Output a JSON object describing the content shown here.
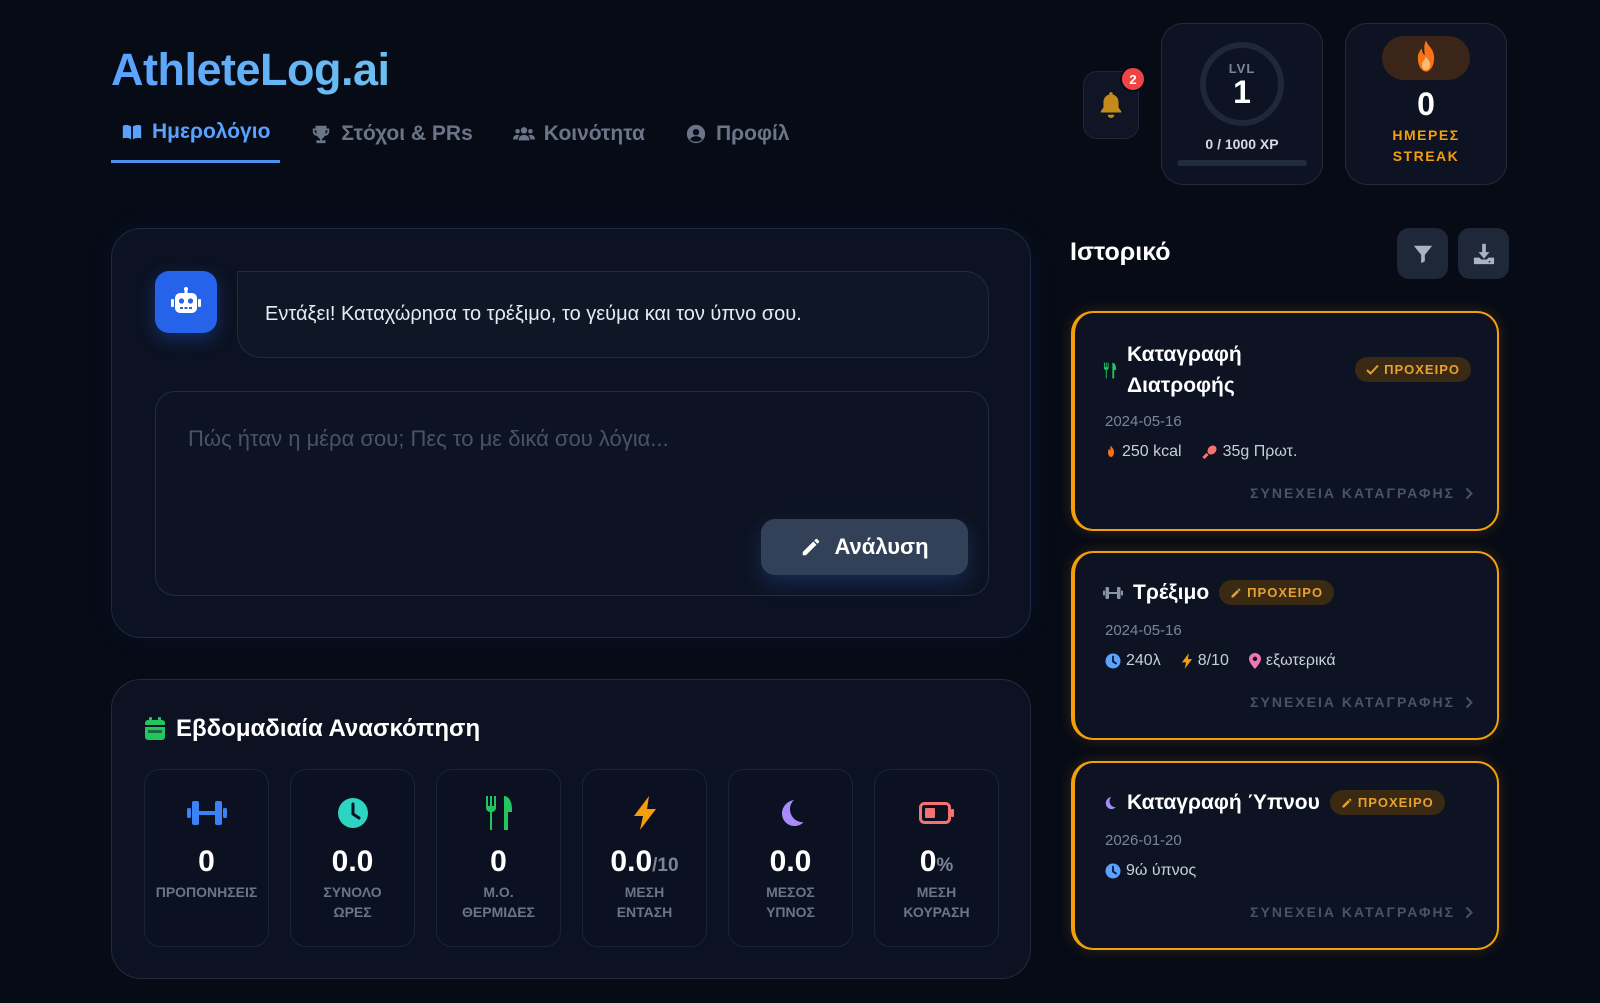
{
  "app": {
    "logo": "AthleteLog.ai"
  },
  "nav": [
    {
      "label": "Ημερολόγιο",
      "active": true
    },
    {
      "label": "Στόχοι & PRs",
      "active": false
    },
    {
      "label": "Κοινότητα",
      "active": false
    },
    {
      "label": "Προφίλ",
      "active": false
    }
  ],
  "notifications": {
    "count": "2"
  },
  "level": {
    "label": "LVL",
    "value": "1",
    "xp_text": "0 / 1000 XP",
    "xp_progress": 0
  },
  "streak": {
    "value": "0",
    "label_line1": "ΗΜΕΡΕΣ",
    "label_line2": "STREAK"
  },
  "chat": {
    "bot_message": "Εντάξει! Καταχώρησα το τρέξιμο, το γεύμα και τον ύπνο σου.",
    "input_placeholder": "Πώς ήταν η μέρα σου; Πες το με δικά σου λόγια...",
    "input_value": "",
    "analyze_label": "Ανάλυση"
  },
  "weekly": {
    "title": "Εβδομαδιαία Ανασκόπηση",
    "tiles": [
      {
        "icon": "dumbbell-icon",
        "value": "0",
        "unit": "",
        "label_line1": "ΠΡΟΠΟΝΗΣΕΙΣ",
        "label_line2": "",
        "color": "#3b82f6"
      },
      {
        "icon": "clock-icon",
        "value": "0.0",
        "unit": "",
        "label_line1": "ΣΥΝΟΛΟ",
        "label_line2": "ΩΡΕΣ",
        "color": "#2dd4bf"
      },
      {
        "icon": "utensils-icon",
        "value": "0",
        "unit": "",
        "label_line1": "Μ.Ο.",
        "label_line2": "ΘΕΡΜΙΔΕΣ",
        "color": "#22c55e"
      },
      {
        "icon": "bolt-icon",
        "value": "0.0",
        "unit": "/10",
        "label_line1": "ΜΕΣΗ",
        "label_line2": "ΕΝΤΑΣΗ",
        "color": "#f59e0b"
      },
      {
        "icon": "moon-icon",
        "value": "0.0",
        "unit": "",
        "label_line1": "ΜΕΣΟΣ",
        "label_line2": "ΥΠΝΟΣ",
        "color": "#a78bfa"
      },
      {
        "icon": "battery-icon",
        "value": "0",
        "unit": "%",
        "label_line1": "ΜΕΣΗ",
        "label_line2": "ΚΟΥΡΑΣΗ",
        "color": "#f87171"
      }
    ]
  },
  "history": {
    "title": "Ιστορικό",
    "continue_label": "ΣΥΝΕΧΕΙΑ ΚΑΤΑΓΡΑΦΗΣ",
    "draft_label": "ΠΡΟΧΕΙΡΟ",
    "cards": [
      {
        "title_line1": "Καταγραφή",
        "title_line2": "Διατροφής",
        "icon": "utensils-icon",
        "date": "2024-05-16",
        "meta": [
          {
            "icon": "fire-icon",
            "text": "250 kcal"
          },
          {
            "icon": "drumstick-icon",
            "text": "35g Πρωτ."
          }
        ]
      },
      {
        "title": "Τρέξιμο",
        "icon": "dumbbell-icon",
        "date": "2024-05-16",
        "meta": [
          {
            "icon": "clock-icon",
            "text": "240λ"
          },
          {
            "icon": "bolt-icon",
            "text": "8/10"
          },
          {
            "icon": "location-pin-icon",
            "text": "εξωτερικά"
          }
        ]
      },
      {
        "title": "Καταγραφή Ύπνου",
        "icon": "moon-icon",
        "date": "2026-01-20",
        "meta": [
          {
            "icon": "clock-icon",
            "text": "9ώ ύπνος"
          }
        ]
      }
    ]
  },
  "colors": {
    "accent": "#4f8ff0",
    "draft": "#f59e0b",
    "background": "#070b16",
    "badge": "#ef4444"
  }
}
